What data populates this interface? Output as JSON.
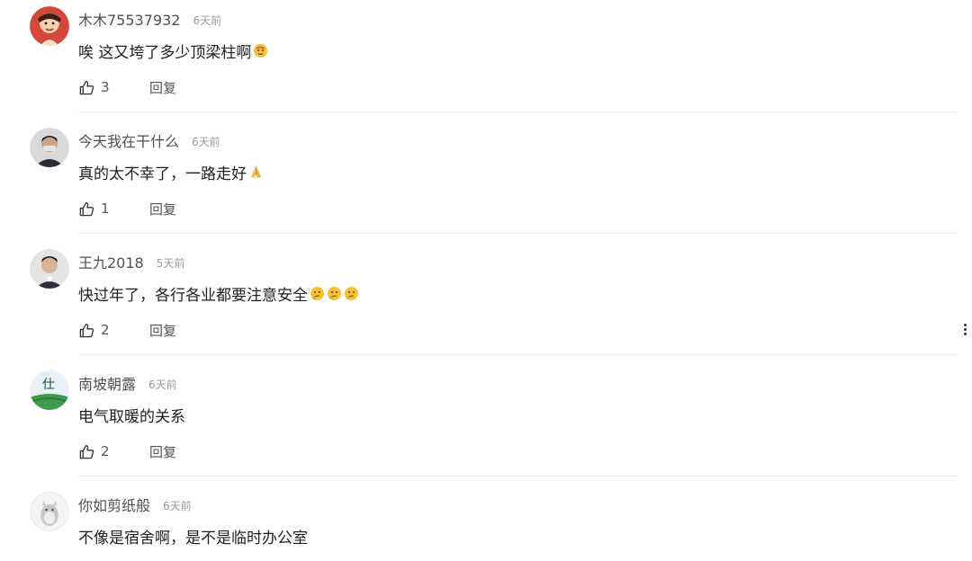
{
  "comments": [
    {
      "username": "木木75537932",
      "time": "6天前",
      "text": "唉 这又垮了多少顶梁柱啊",
      "emojis": [
        "hot-face"
      ],
      "likes": "3",
      "reply_label": "回复"
    },
    {
      "username": "今天我在干什么",
      "time": "6天前",
      "text": "真的太不幸了，一路走好",
      "emojis": [
        "folded-hands"
      ],
      "likes": "1",
      "reply_label": "回复"
    },
    {
      "username": "王九2018",
      "time": "5天前",
      "text": "快过年了，各行各业都要注意安全",
      "emojis": [
        "thinking-face",
        "thinking-face",
        "thinking-face"
      ],
      "likes": "2",
      "reply_label": "回复"
    },
    {
      "username": "南坡朝露",
      "time": "6天前",
      "text": "电气取暖的关系",
      "emojis": [],
      "likes": "2",
      "reply_label": "回复"
    },
    {
      "username": "你如剪纸般",
      "time": "6天前",
      "text": "不像是宿舍啊，是不是临时办公室",
      "emojis": [],
      "likes": "",
      "reply_label": ""
    }
  ],
  "avatar_colors": {
    "c0": "#d7463b",
    "c1": "#3b3f44",
    "c2": "#5d6066",
    "c3": "#2e8a4a",
    "c4": "#eeeeee"
  },
  "icons": {
    "like": "thumbs-up-icon",
    "more": "more-vertical-icon"
  }
}
